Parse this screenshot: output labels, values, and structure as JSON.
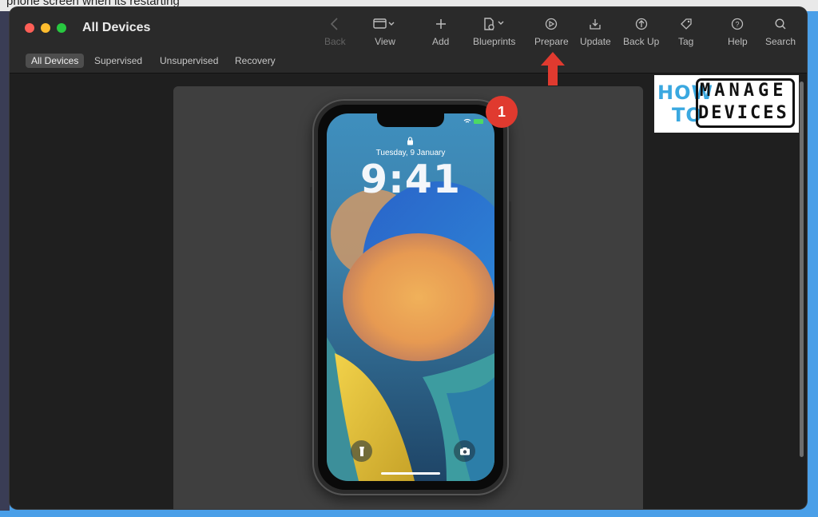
{
  "background": {
    "top_text": "phone screen when its restarting"
  },
  "window": {
    "title": "All Devices"
  },
  "toolbar": {
    "back": "Back",
    "view": "View",
    "add": "Add",
    "blueprints": "Blueprints",
    "prepare": "Prepare",
    "update": "Update",
    "back_up": "Back Up",
    "tag": "Tag",
    "help": "Help",
    "search": "Search"
  },
  "tabs": [
    "All Devices",
    "Supervised",
    "Unsupervised",
    "Recovery"
  ],
  "device": {
    "date": "Tuesday, 9 January",
    "time": "9:41"
  },
  "annotation": {
    "badge_number": "1"
  },
  "logo": {
    "how": "HOW",
    "to": "TO",
    "manage": "MANAGE",
    "devices": "DEVICES"
  },
  "colors": {
    "accent_red": "#e03a2f",
    "frame_blue": "#4a9fe8",
    "logo_blue": "#3aa8e0"
  }
}
